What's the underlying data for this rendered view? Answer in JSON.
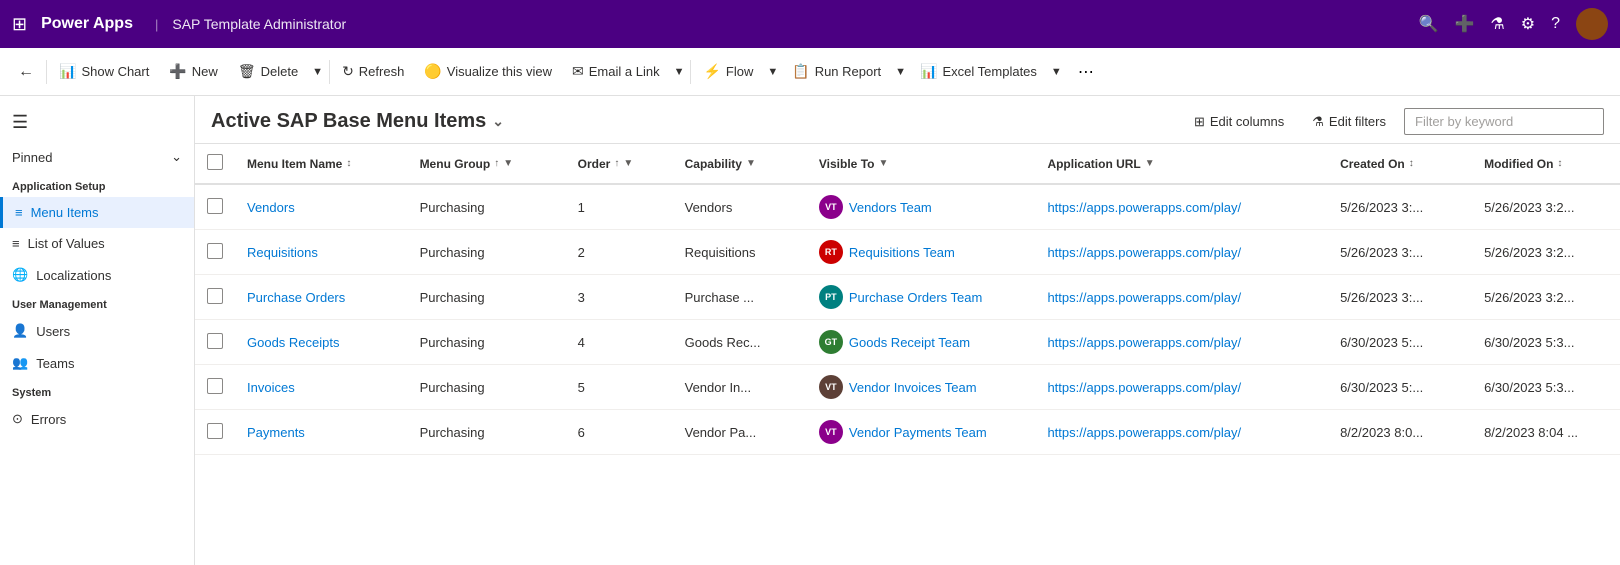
{
  "topNav": {
    "appName": "Power Apps",
    "separator": "|",
    "appTitle": "SAP Template Administrator"
  },
  "toolbar": {
    "backBtn": "←",
    "showChart": "Show Chart",
    "new": "New",
    "delete": "Delete",
    "refresh": "Refresh",
    "visualizeView": "Visualize this view",
    "emailLink": "Email a Link",
    "flow": "Flow",
    "runReport": "Run Report",
    "excelTemplates": "Excel Templates",
    "moreBtn": "⋯"
  },
  "pageHeader": {
    "title": "Active SAP Base Menu Items",
    "dropdownArrow": "⌄",
    "editColumns": "Edit columns",
    "editFilters": "Edit filters",
    "filterPlaceholder": "Filter by keyword"
  },
  "sidebar": {
    "hamburgerIcon": "☰",
    "pinned": "Pinned",
    "pinnedArrow": "⌄",
    "applicationSetup": "Application Setup",
    "menuItems": "Menu Items",
    "listOfValues": "List of Values",
    "localizations": "Localizations",
    "userManagement": "User Management",
    "users": "Users",
    "teams": "Teams",
    "system": "System",
    "errors": "Errors"
  },
  "table": {
    "columns": [
      {
        "key": "menuItemName",
        "label": "Menu Item Name",
        "sortable": true,
        "sort": "asc"
      },
      {
        "key": "menuGroup",
        "label": "Menu Group",
        "sortable": true,
        "sort": "asc"
      },
      {
        "key": "order",
        "label": "Order",
        "sortable": true,
        "sort": "asc"
      },
      {
        "key": "capability",
        "label": "Capability",
        "sortable": true,
        "sort": null
      },
      {
        "key": "visibleTo",
        "label": "Visible To",
        "sortable": true,
        "sort": null
      },
      {
        "key": "applicationUrl",
        "label": "Application URL",
        "sortable": true,
        "sort": null
      },
      {
        "key": "createdOn",
        "label": "Created On",
        "sortable": true,
        "sort": null
      },
      {
        "key": "modifiedOn",
        "label": "Modified On",
        "sortable": true,
        "sort": null
      }
    ],
    "rows": [
      {
        "menuItemName": "Vendors",
        "menuGroup": "Purchasing",
        "order": "1",
        "capability": "Vendors",
        "visibleTo": "Vendors Team",
        "visibleToInitials": "VT",
        "visibleToColor": "#8B008B",
        "applicationUrl": "https://apps.powerapps.com/play/",
        "createdOn": "5/26/2023 3:...",
        "modifiedOn": "5/26/2023 3:2..."
      },
      {
        "menuItemName": "Requisitions",
        "menuGroup": "Purchasing",
        "order": "2",
        "capability": "Requisitions",
        "visibleTo": "Requisitions Team",
        "visibleToInitials": "RT",
        "visibleToColor": "#cc0000",
        "applicationUrl": "https://apps.powerapps.com/play/",
        "createdOn": "5/26/2023 3:...",
        "modifiedOn": "5/26/2023 3:2..."
      },
      {
        "menuItemName": "Purchase Orders",
        "menuGroup": "Purchasing",
        "order": "3",
        "capability": "Purchase ...",
        "visibleTo": "Purchase Orders Team",
        "visibleToInitials": "PT",
        "visibleToColor": "#008080",
        "applicationUrl": "https://apps.powerapps.com/play/",
        "createdOn": "5/26/2023 3:...",
        "modifiedOn": "5/26/2023 3:2..."
      },
      {
        "menuItemName": "Goods Receipts",
        "menuGroup": "Purchasing",
        "order": "4",
        "capability": "Goods Rec...",
        "visibleTo": "Goods Receipt Team",
        "visibleToInitials": "GT",
        "visibleToColor": "#2e7d32",
        "applicationUrl": "https://apps.powerapps.com/play/",
        "createdOn": "6/30/2023 5:...",
        "modifiedOn": "6/30/2023 5:3..."
      },
      {
        "menuItemName": "Invoices",
        "menuGroup": "Purchasing",
        "order": "5",
        "capability": "Vendor In...",
        "visibleTo": "Vendor Invoices Team",
        "visibleToInitials": "VT",
        "visibleToColor": "#5d4037",
        "applicationUrl": "https://apps.powerapps.com/play/",
        "createdOn": "6/30/2023 5:...",
        "modifiedOn": "6/30/2023 5:3..."
      },
      {
        "menuItemName": "Payments",
        "menuGroup": "Purchasing",
        "order": "6",
        "capability": "Vendor Pa...",
        "visibleTo": "Vendor Payments Team",
        "visibleToInitials": "VT",
        "visibleToColor": "#8B008B",
        "applicationUrl": "https://apps.powerapps.com/play/",
        "createdOn": "8/2/2023 8:0...",
        "modifiedOn": "8/2/2023 8:04 ..."
      }
    ]
  }
}
